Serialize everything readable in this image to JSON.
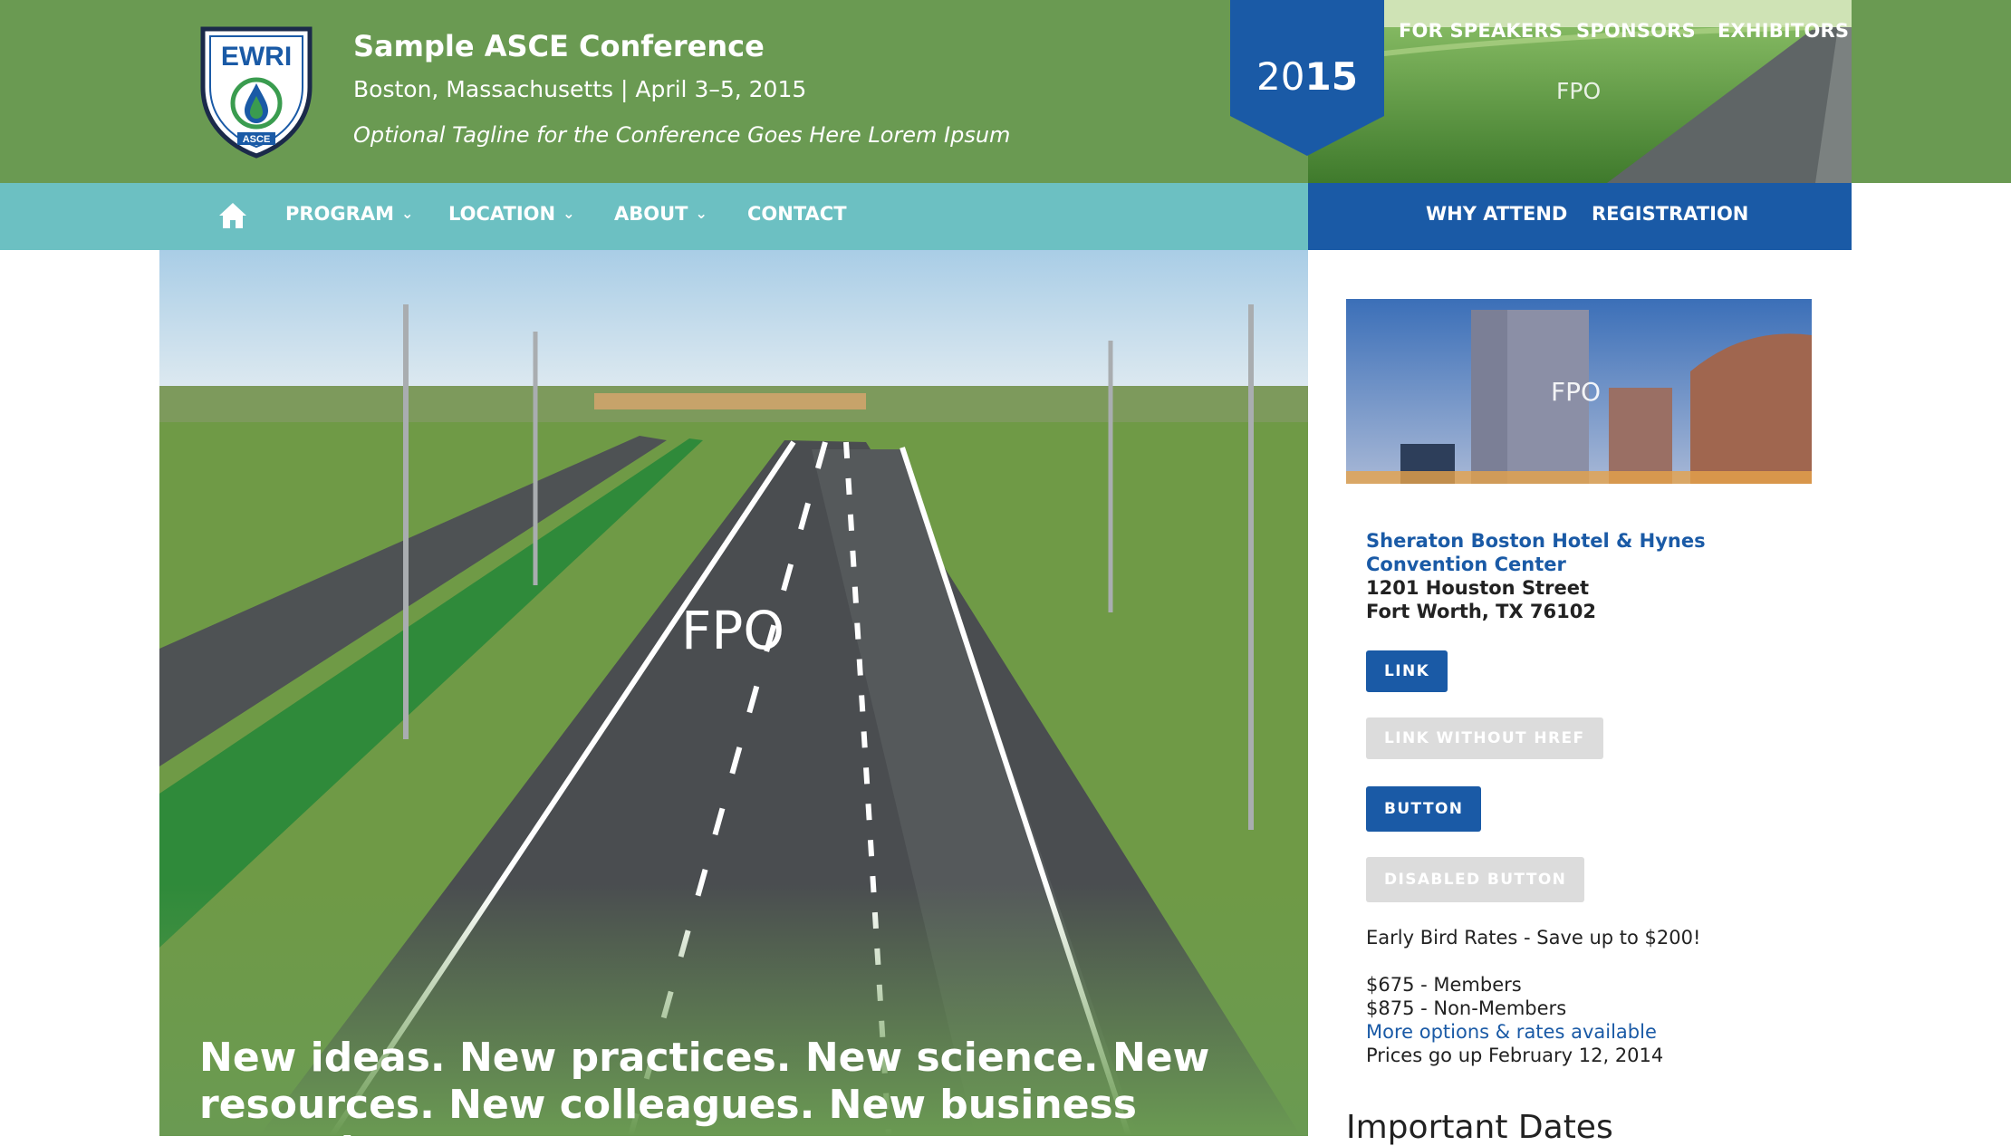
{
  "header": {
    "logo_text": "EWRI",
    "logo_subtext": "ASCE",
    "title": "Sample ASCE Conference",
    "subtitle": "Boston, Massachusetts | April 3–5, 2015",
    "tagline": "Optional Tagline for the Conference Goes Here Lorem Ipsum",
    "year_light": "20",
    "year_bold": "15",
    "utility_nav": [
      "FOR SPEAKERS",
      "SPONSORS",
      "EXHIBITORS"
    ],
    "photo_placeholder": "FPO"
  },
  "main_nav": {
    "home_icon": "home-icon",
    "items": [
      {
        "label": "PROGRAM",
        "dropdown": true
      },
      {
        "label": "LOCATION",
        "dropdown": true
      },
      {
        "label": "ABOUT",
        "dropdown": true
      },
      {
        "label": "CONTACT",
        "dropdown": false
      }
    ],
    "secondary_items": [
      "WHY ATTEND",
      "REGISTRATION"
    ]
  },
  "hero": {
    "placeholder": "FPO",
    "headline": "New ideas. New practices. New science. New resources. New colleagues. New business procedures."
  },
  "sidebar": {
    "photo_placeholder": "FPO",
    "hotel_name": "Sheraton Boston Hotel & Hynes Convention Center",
    "address_line1": "1201 Houston Street",
    "address_line2": "Fort Worth, TX 76102",
    "buttons": {
      "link": "LINK",
      "link_without_href": "LINK WITHOUT HREF",
      "button": "BUTTON",
      "disabled_button": "DISABLED BUTTON"
    },
    "early_bird": "Early Bird Rates - Save up to $200!",
    "rate_members": "$675 - Members",
    "rate_non_members": "$875 - Non-Members",
    "more_options": "More options & rates available",
    "prices_note": "Prices go up February 12, 2014",
    "important_dates_heading": "Important Dates"
  },
  "colors": {
    "header_green": "#6a9a52",
    "nav_teal": "#6cc0c2",
    "brand_blue": "#1a5aa6",
    "disabled_grey": "#dcdcdc"
  }
}
